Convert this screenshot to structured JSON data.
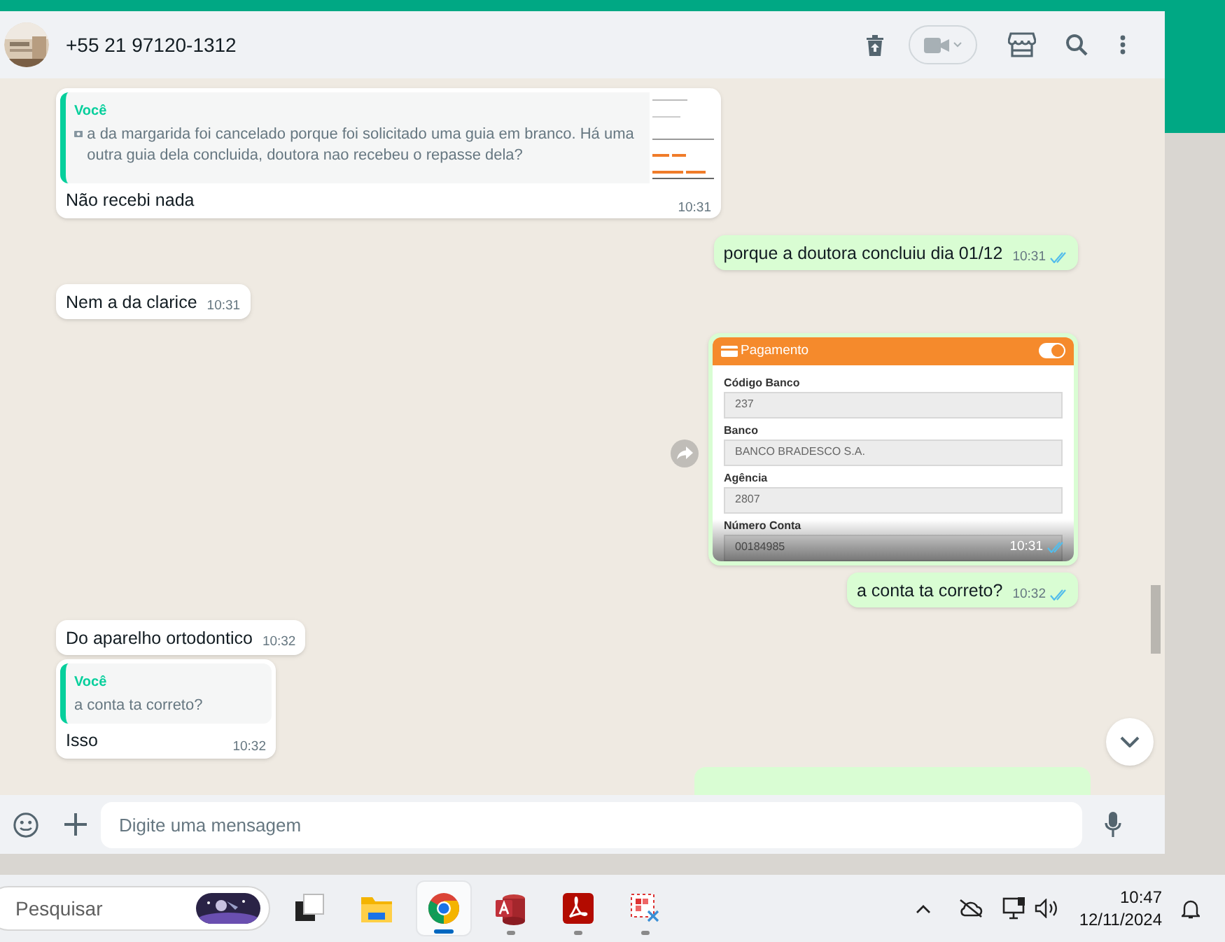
{
  "header": {
    "contact": "+55 21 97120-1312"
  },
  "messages": [
    {
      "kind": "reply",
      "outgoing": false,
      "quote_author": "Você",
      "quote_photo": true,
      "quote_text": "a da margarida foi cancelado porque foi solicitado uma guia em branco. Há uma outra guia dela concluida, doutora nao recebeu o repasse dela?",
      "quote_thumbnail": true,
      "text": "Não recebi nada",
      "time": "10:31"
    },
    {
      "kind": "text",
      "outgoing": true,
      "text": "porque a doutora concluiu dia 01/12",
      "time": "10:31",
      "read": true
    },
    {
      "kind": "text",
      "outgoing": false,
      "text": "Nem a da clarice",
      "time": "10:31"
    },
    {
      "outgoing": true,
      "time": "10:31",
      "read": true,
      "forward": true,
      "form": {
        "title": "Pagamento",
        "toggle_on": true,
        "fields": [
          {
            "label": "Código Banco",
            "value": "237"
          },
          {
            "label": "Banco",
            "value": "BANCO BRADESCO S.A."
          },
          {
            "label": "Agência",
            "value": "2807"
          },
          {
            "label": "Número Conta",
            "value": "00184985"
          }
        ]
      }
    },
    {
      "kind": "text",
      "outgoing": true,
      "text": "a conta ta correto?",
      "time": "10:32",
      "read": true
    },
    {
      "kind": "text",
      "outgoing": false,
      "text": "Do aparelho ortodontico",
      "time": "10:32"
    },
    {
      "kind": "reply",
      "outgoing": false,
      "quote_author": "Você",
      "quote_photo": false,
      "quote_text": "a conta ta correto?",
      "quote_thumbnail": false,
      "text": "Isso",
      "time": "10:32"
    },
    {
      "kind": "partial",
      "outgoing": true
    }
  ],
  "composer": {
    "placeholder": "Digite uma mensagem"
  },
  "taskbar": {
    "search_placeholder": "Pesquisar",
    "apps": [
      {
        "kind": "taskview",
        "running": false,
        "selected": false
      },
      {
        "kind": "folder",
        "running": false,
        "selected": false
      },
      {
        "kind": "browser",
        "running": true,
        "selected": true
      },
      {
        "kind": "database",
        "running": true,
        "selected": false
      },
      {
        "kind": "pdf",
        "running": true,
        "selected": false
      },
      {
        "kind": "snip",
        "running": true,
        "selected": false
      }
    ],
    "time": "10:47",
    "date": "12/11/2024"
  }
}
